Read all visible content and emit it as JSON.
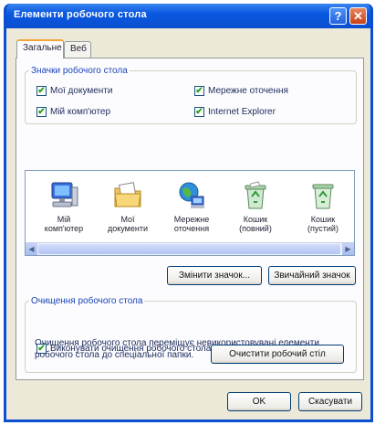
{
  "window": {
    "title": "Елементи робочого стола",
    "help_glyph": "?",
    "close_glyph": "✕"
  },
  "tabs": [
    {
      "label": "Загальне",
      "active": true
    },
    {
      "label": "Веб",
      "active": false
    }
  ],
  "icons_group": {
    "legend": "Значки робочого стола",
    "items": [
      {
        "label": "Мої документи",
        "checked": true
      },
      {
        "label": "Мережне оточення",
        "checked": true
      },
      {
        "label": "Мій комп'ютер",
        "checked": true
      },
      {
        "label": "Internet Explorer",
        "checked": true
      }
    ]
  },
  "icon_list": [
    {
      "line1": "Мій",
      "line2": "комп'ютер",
      "icon": "computer-icon"
    },
    {
      "line1": "Мої",
      "line2": "документи",
      "icon": "documents-icon"
    },
    {
      "line1": "Мережне",
      "line2": "оточення",
      "icon": "network-icon"
    },
    {
      "line1": "Кошик",
      "line2": "(повний)",
      "icon": "recycle-bin-full-icon"
    },
    {
      "line1": "Кошик",
      "line2": "(пустий)",
      "icon": "recycle-bin-empty-icon"
    }
  ],
  "buttons": {
    "change_icon": "Змінити значок...",
    "default_icon": "Звичайний значок",
    "cleanup_now": "Очистити робочий стіл",
    "ok": "OK",
    "cancel": "Скасувати"
  },
  "cleanup_group": {
    "legend": "Очищення робочого стола",
    "description": "Очищення робочого стола переміщує невикористовувані елементи робочого стола до спеціальної папки.",
    "checkbox_label": "Виконувати очищення робочого стола кожні 60 днів",
    "checked": true
  },
  "scrollbar": {
    "left_arrow": "◀",
    "right_arrow": "▶"
  },
  "colors": {
    "titlebar": "#0a58e0",
    "dialog_bg": "#ece9d8",
    "check": "#21a121",
    "accent_tab": "#f3a53a"
  }
}
